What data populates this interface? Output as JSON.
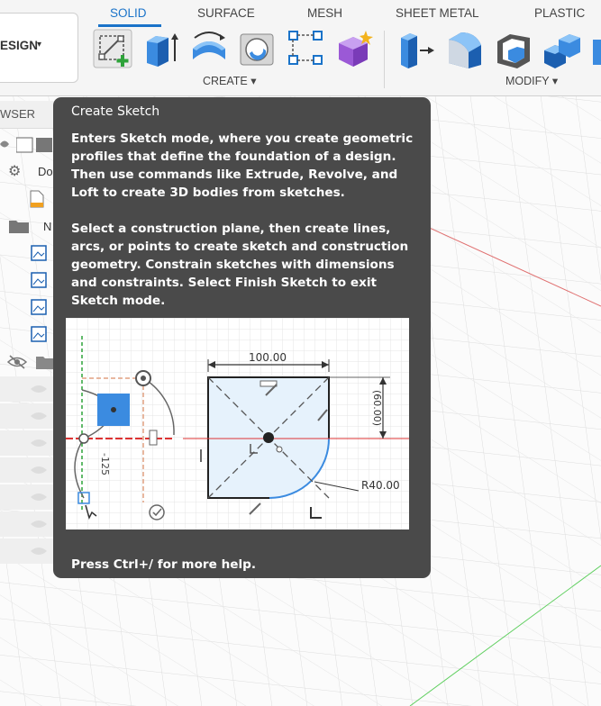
{
  "ribbon": {
    "workspace": {
      "label": "ESIGN",
      "caret": "▾"
    },
    "tabs": [
      {
        "label": "SOLID",
        "active": true
      },
      {
        "label": "SURFACE",
        "active": false
      },
      {
        "label": "MESH",
        "active": false
      },
      {
        "label": "SHEET METAL",
        "active": false
      },
      {
        "label": "PLASTIC",
        "active": false
      }
    ],
    "groups": {
      "create": "CREATE ▾",
      "modify": "MODIFY ▾"
    },
    "tools": {
      "create": [
        "create-sketch-icon",
        "extrude-icon",
        "revolve-icon",
        "hole-icon",
        "pattern-icon",
        "form-icon"
      ],
      "modify": [
        "press-pull-icon",
        "fillet-icon",
        "shell-icon",
        "combine-icon",
        "align-icon"
      ]
    }
  },
  "browser": {
    "title": "WSER",
    "rows": [
      {
        "icon": "component-icon",
        "text": ""
      },
      {
        "icon": "gear-icon",
        "text": "Do"
      },
      {
        "icon": "document-icon",
        "text": ""
      },
      {
        "icon": "folder-icon",
        "text": "N"
      },
      {
        "icon": "image-icon",
        "text": ""
      },
      {
        "icon": "image-icon",
        "text": ""
      },
      {
        "icon": "image-icon",
        "text": ""
      },
      {
        "icon": "image-icon",
        "text": ""
      },
      {
        "icon": "eye-hidden-icon",
        "text": ""
      }
    ]
  },
  "tooltip": {
    "title": "Create Sketch",
    "paragraph1": "Enters Sketch mode, where you create geometric profiles that define the foundation of a design. Then use commands like Extrude, Revolve, and Loft to create 3D bodies from sketches.",
    "paragraph2": "Select a construction plane, then create lines, arcs, or points to create sketch and construction geometry. Constrain sketches with dimensions and constraints. Select Finish Sketch to exit Sketch mode.",
    "illustration": {
      "dim_width": "100.00",
      "dim_height": "(60.00)",
      "dim_radius": "R40.00",
      "dim_left": "-125"
    },
    "footer": "Press Ctrl+/ for more help."
  },
  "colors": {
    "accent": "#1a73c9",
    "tooltip_bg": "#4a4a4a",
    "sketch_green": "#3aa83a"
  }
}
